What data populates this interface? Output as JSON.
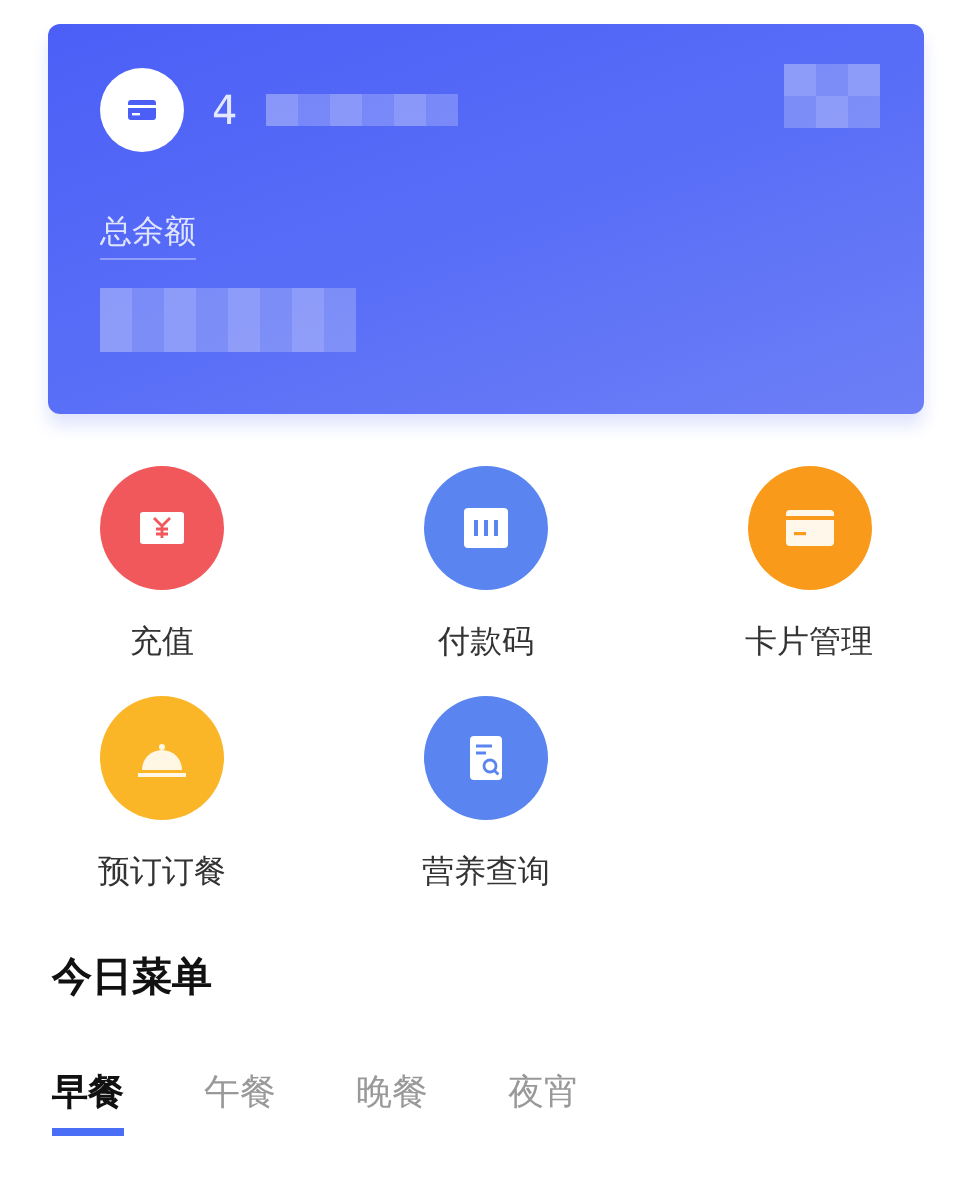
{
  "card": {
    "number": "4",
    "balance_label": "总余额"
  },
  "shortcuts": [
    {
      "label": "充值",
      "kind": "cash",
      "color": "#f0585c"
    },
    {
      "label": "付款码",
      "kind": "code",
      "color": "#5a84ef"
    },
    {
      "label": "卡片管理",
      "kind": "card",
      "color": "#fa9a1a"
    },
    {
      "label": "预订订餐",
      "kind": "dish",
      "color": "#fbb628"
    },
    {
      "label": "营养查询",
      "kind": "report",
      "color": "#5a84ef"
    }
  ],
  "menu": {
    "title": "今日菜单",
    "tabs": [
      {
        "label": "早餐",
        "selected": true
      },
      {
        "label": "午餐",
        "selected": false
      },
      {
        "label": "晚餐",
        "selected": false
      },
      {
        "label": "夜宵",
        "selected": false
      }
    ]
  }
}
